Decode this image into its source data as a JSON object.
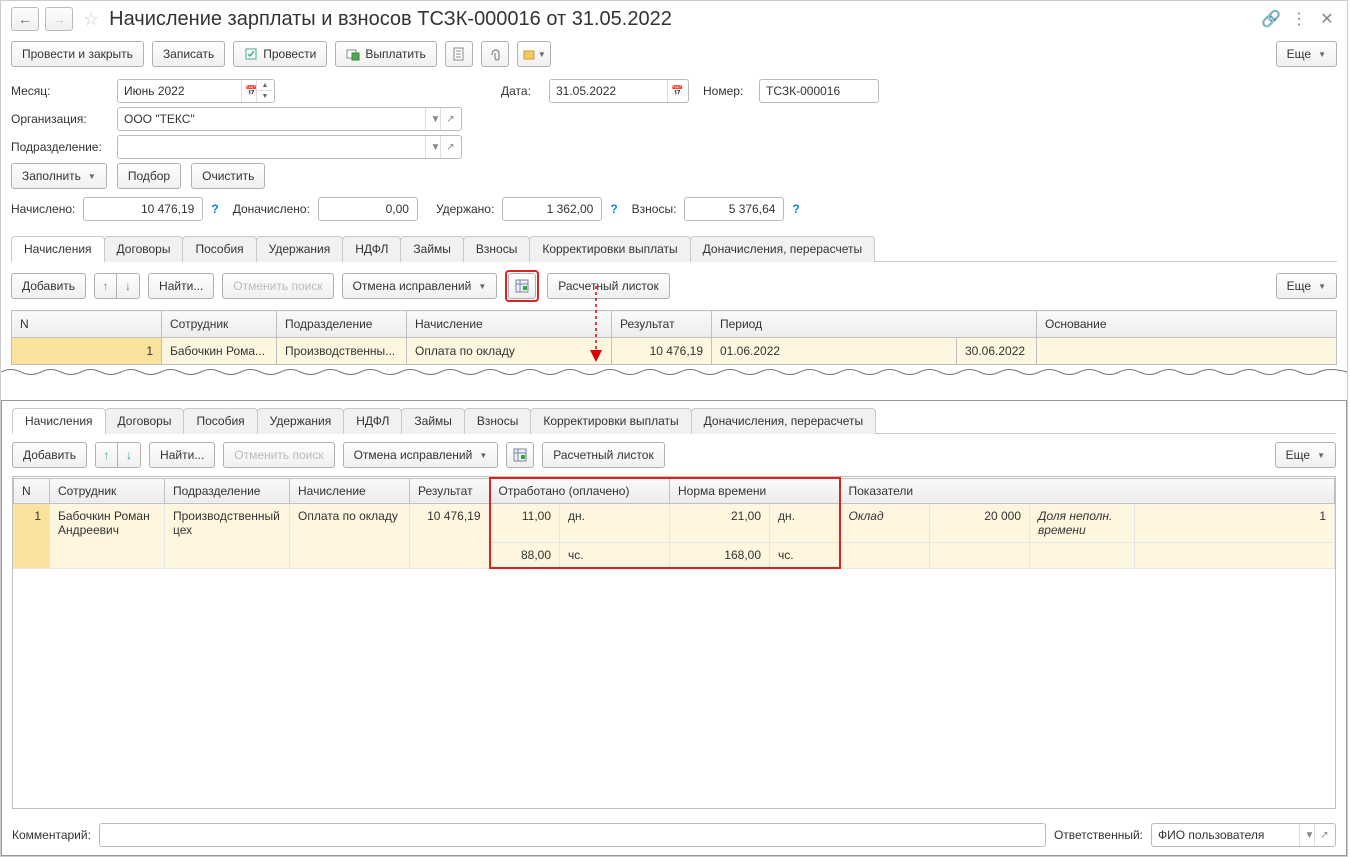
{
  "header": {
    "title": "Начисление зарплаты и взносов ТСЗК-000016 от 31.05.2022"
  },
  "toolbar": {
    "save_close": "Провести и закрыть",
    "write": "Записать",
    "post": "Провести",
    "pay": "Выплатить",
    "more": "Еще"
  },
  "fields": {
    "month_label": "Месяц:",
    "month_value": "Июнь 2022",
    "date_label": "Дата:",
    "date_value": "31.05.2022",
    "number_label": "Номер:",
    "number_value": "ТСЗК-000016",
    "org_label": "Организация:",
    "org_value": "ООО \"ТЕКС\"",
    "dept_label": "Подразделение:",
    "dept_value": ""
  },
  "actions": {
    "fill": "Заполнить",
    "select": "Подбор",
    "clear": "Очистить"
  },
  "totals": {
    "accrued_label": "Начислено:",
    "accrued_value": "10 476,19",
    "extra_label": "Доначислено:",
    "extra_value": "0,00",
    "withheld_label": "Удержано:",
    "withheld_value": "1 362,00",
    "contrib_label": "Взносы:",
    "contrib_value": "5 376,64"
  },
  "tabs": [
    "Начисления",
    "Договоры",
    "Пособия",
    "Удержания",
    "НДФЛ",
    "Займы",
    "Взносы",
    "Корректировки выплаты",
    "Доначисления, перерасчеты"
  ],
  "subtb": {
    "add": "Добавить",
    "find": "Найти...",
    "cancel_search": "Отменить поиск",
    "cancel_fix": "Отмена исправлений",
    "payslip": "Расчетный листок",
    "more": "Еще"
  },
  "grid1": {
    "cols": [
      "N",
      "Сотрудник",
      "Подразделение",
      "Начисление",
      "Результат",
      "Период",
      "Основание"
    ],
    "row": {
      "n": "1",
      "emp": "Бабочкин Рома...",
      "dept": "Производственны...",
      "accr": "Оплата по окладу",
      "res": "10 476,19",
      "p_from": "01.06.2022",
      "p_to": "30.06.2022",
      "basis": ""
    }
  },
  "grid2": {
    "cols": {
      "n": "N",
      "emp": "Сотрудник",
      "dept": "Подразделение",
      "accr": "Начисление",
      "res": "Результат",
      "worked": "Отработано (оплачено)",
      "norm": "Норма времени",
      "ind": "Показатели"
    },
    "row": {
      "n": "1",
      "emp": "Бабочкин Роман Андреевич",
      "dept": "Производственный цех",
      "accr": "Оплата по окладу",
      "res": "10 476,19",
      "worked_d": "11,00",
      "worked_d_u": "дн.",
      "worked_h": "88,00",
      "worked_h_u": "чс.",
      "norm_d": "21,00",
      "norm_d_u": "дн.",
      "norm_h": "168,00",
      "norm_h_u": "чс.",
      "ind1_n": "Оклад",
      "ind1_v": "20 000",
      "ind2_n": "Доля неполн. времени",
      "ind2_v": "1"
    }
  },
  "footer": {
    "comment_label": "Комментарий:",
    "resp_label": "Ответственный:",
    "resp_value": "ФИО пользователя"
  }
}
